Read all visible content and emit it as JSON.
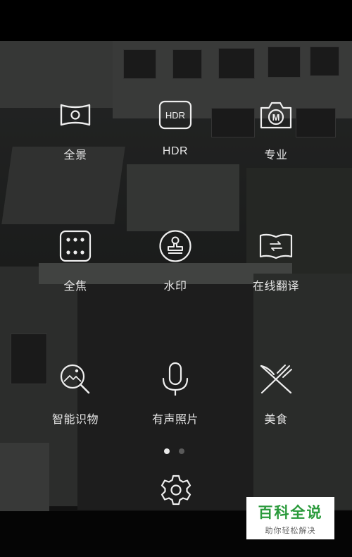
{
  "modes": {
    "panorama": {
      "label": "全景",
      "icon": "panorama-icon"
    },
    "hdr": {
      "label": "HDR",
      "icon_text": "HDR",
      "icon": "hdr-icon"
    },
    "pro": {
      "label": "专业",
      "icon_text": "M",
      "icon": "pro-camera-icon"
    },
    "all_focus": {
      "label": "全焦",
      "icon": "all-focus-grid-icon"
    },
    "watermark": {
      "label": "水印",
      "icon": "stamp-icon"
    },
    "translate": {
      "label": "在线翻译",
      "icon": "book-translate-icon"
    },
    "object_recognition": {
      "label": "智能识物",
      "icon": "image-search-icon"
    },
    "audio_photo": {
      "label": "有声照片",
      "icon": "microphone-icon"
    },
    "food": {
      "label": "美食",
      "icon": "fork-knife-icon"
    }
  },
  "pager": {
    "pages": 2,
    "current": 1
  },
  "settings": {
    "label": "设置",
    "icon": "gear-icon"
  },
  "site_watermark": {
    "title": "百科全说",
    "subtitle": "助你轻松解决"
  },
  "colors": {
    "text": "#e6e6e6",
    "watermark_green": "#2a9a3b",
    "dot_inactive": "#5a5a5a"
  }
}
